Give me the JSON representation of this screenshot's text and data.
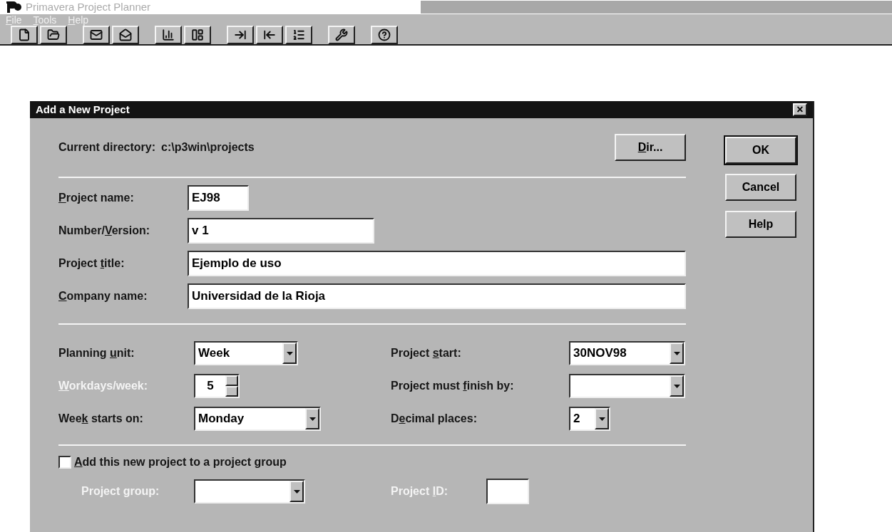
{
  "app": {
    "title": "Primavera Project Planner"
  },
  "menu": [
    {
      "label": {
        "key": "F",
        "post": "ile"
      }
    },
    {
      "label": {
        "key": "T",
        "post": "ools"
      }
    },
    {
      "label": {
        "key": "H",
        "post": "elp"
      }
    }
  ],
  "dialog": {
    "title": "Add a New Project",
    "close": "×",
    "current_directory": {
      "label": "Current directory:",
      "value": "c:\\p3win\\projects"
    },
    "dir_button": {
      "label": {
        "key": "D",
        "post": "ir..."
      }
    },
    "buttons": [
      {
        "label": "OK",
        "default": true
      },
      {
        "label": "Cancel",
        "default": false
      },
      {
        "label": "Help",
        "default": false
      }
    ],
    "fields": [
      {
        "label": {
          "key": "P",
          "post": "roject name:"
        },
        "value": "EJ98"
      },
      {
        "label": {
          "pre": "Number/",
          "key": "V",
          "post": "ersion:"
        },
        "value": "v 1"
      },
      {
        "label": {
          "pre": "Project ",
          "key": "t",
          "post": "itle:"
        },
        "value": "Ejemplo de uso"
      },
      {
        "label": {
          "key": "C",
          "post": "ompany name:"
        },
        "value": "Universidad de la Rioja"
      }
    ],
    "settings_left": [
      {
        "kind": "dropdown",
        "label": {
          "pre": "Planning ",
          "key": "u",
          "post": "nit:"
        },
        "value": "Week",
        "disabled": false
      },
      {
        "kind": "spinner",
        "label": {
          "key": "W",
          "post": "orkdays/week:"
        },
        "value": "5",
        "disabled": true
      },
      {
        "kind": "dropdown",
        "label": {
          "pre": "Wee",
          "key": "k",
          "post": " starts on:"
        },
        "value": "Monday",
        "disabled": false
      }
    ],
    "settings_right": [
      {
        "kind": "dropdown",
        "label": {
          "pre": "Project ",
          "key": "s",
          "post": "tart:"
        },
        "value": "30NOV98",
        "disabled": false
      },
      {
        "kind": "dropdown",
        "label": {
          "pre": "Project must ",
          "key": "f",
          "post": "inish by:"
        },
        "disabled": false
      },
      {
        "kind": "dropdown",
        "label": {
          "pre": "D",
          "key": "e",
          "post": "cimal places:"
        },
        "value": "2",
        "disabled": false
      }
    ],
    "group_checkbox": {
      "label": {
        "key": "A",
        "post": "dd this new project to a project group"
      },
      "checked": false
    },
    "project_group": {
      "label": "Project group:",
      "disabled": true
    },
    "project_id": {
      "label": {
        "pre": "Project ",
        "key": "I",
        "post": "D:"
      },
      "disabled": true
    }
  }
}
